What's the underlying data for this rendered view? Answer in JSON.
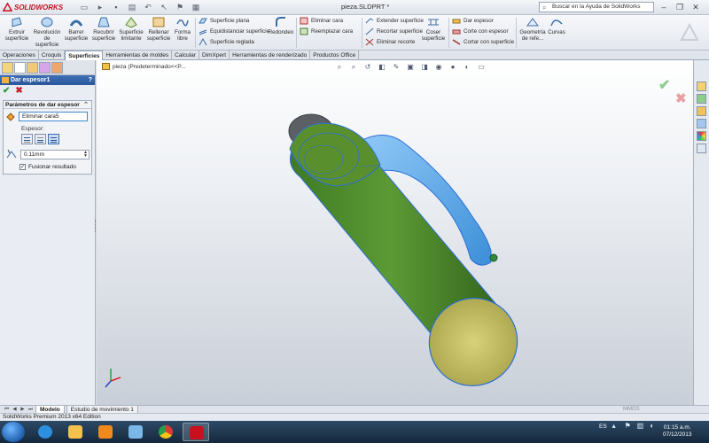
{
  "app": {
    "brand": "SOLIDWORKS",
    "document_title": "pieza.SLDPRT *",
    "help_search_placeholder": "Buscar en la Ayuda de SolidWorks"
  },
  "toolbar": {
    "big_tools": [
      {
        "label": "Extruir superficie"
      },
      {
        "label": "Revolución de superficie"
      },
      {
        "label": "Barrer superficie"
      },
      {
        "label": "Recubrir superficie"
      },
      {
        "label": "Superficie limitante"
      },
      {
        "label": "Rellenar superficie"
      },
      {
        "label": "Forma libre"
      }
    ],
    "col1": [
      "Superficie plana",
      "Equidistanciar superficie",
      "Superficie reglada"
    ],
    "redondeo": "Redondeo",
    "col2": [
      "Eliminar cara",
      "Reemplazar cara"
    ],
    "col3": [
      "Extender superficie",
      "Recortar superficie",
      "Eliminar recorte"
    ],
    "coser": "Coser superficie",
    "col4": [
      "Dar espesor",
      "Corte con espesor",
      "Cortar con superficie"
    ],
    "geometria": "Geometría de refe...",
    "curvas": "Curvas"
  },
  "tabs": [
    "Operaciones",
    "Croquis",
    "Superficies",
    "Herramientas de moldes",
    "Calcular",
    "DimXpert",
    "Herramientas de renderizado",
    "Productos Office"
  ],
  "active_tab": "Superficies",
  "property_manager": {
    "title": "Dar espesor1",
    "group_title": "Parámetros de dar espesor",
    "face_value": "Eliminar cara5",
    "espesor_label": "Espesor:",
    "thickness_value": "0.11mm",
    "merge_label": "Fusionar resultado",
    "merge_checked": true
  },
  "viewport": {
    "tree_label": "pieza  (Predeterminado<<P..."
  },
  "bottom_tabs": [
    "Modelo",
    "Estudio de movimiento 1"
  ],
  "status_text": "SolidWorks Premium 2013 x64 Edition",
  "status_ghost": "MMGS",
  "taskbar": {
    "lang": "ES",
    "time": "01:15 a.m.",
    "date": "07/12/2013"
  },
  "colors": {
    "body_green": "#4f8a2c",
    "face_yellow": "#c8c466",
    "clip_blue": "#5aa7ea",
    "edge_blue": "#2b6fd6"
  }
}
